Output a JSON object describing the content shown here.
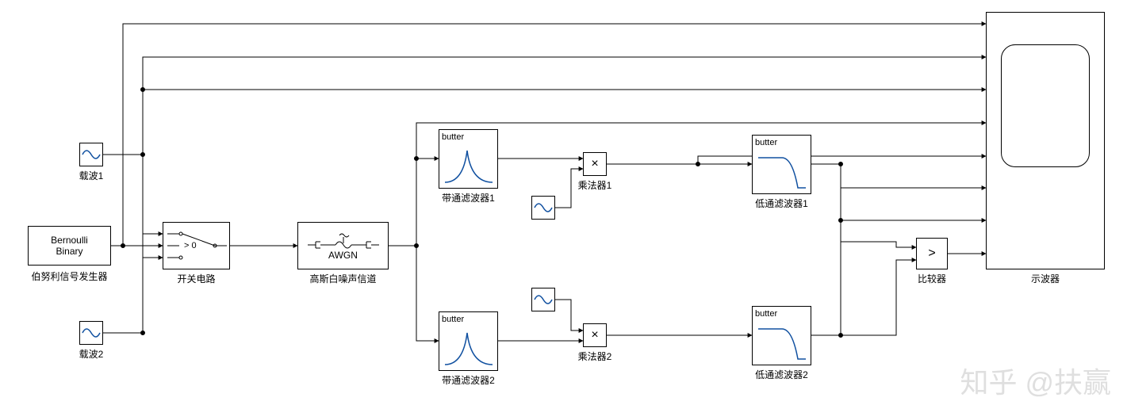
{
  "blocks": {
    "bernoulli": {
      "line1": "Bernoulli",
      "line2": "Binary",
      "label": "伯努利信号发生器"
    },
    "carrier1": {
      "label": "载波1"
    },
    "carrier2": {
      "label": "载波2"
    },
    "switch": {
      "text": "> 0",
      "label": "开关电路"
    },
    "awgn": {
      "text": "AWGN",
      "label": "高斯白噪声信道"
    },
    "bpf1": {
      "text": "butter",
      "label": "带通滤波器1"
    },
    "bpf2": {
      "text": "butter",
      "label": "带通滤波器2"
    },
    "mult1": {
      "symbol": "×",
      "label": "乘法器1"
    },
    "mult2": {
      "symbol": "×",
      "label": "乘法器2"
    },
    "lpf1": {
      "text": "butter",
      "label": "低通滤波器1"
    },
    "lpf2": {
      "text": "butter",
      "label": "低通滤波器2"
    },
    "comparator": {
      "symbol": ">",
      "label": "比较器"
    },
    "scope": {
      "label": "示波器"
    },
    "lo1": {
      "label": ""
    },
    "lo2": {
      "label": ""
    }
  },
  "watermark": "知乎 @扶赢"
}
